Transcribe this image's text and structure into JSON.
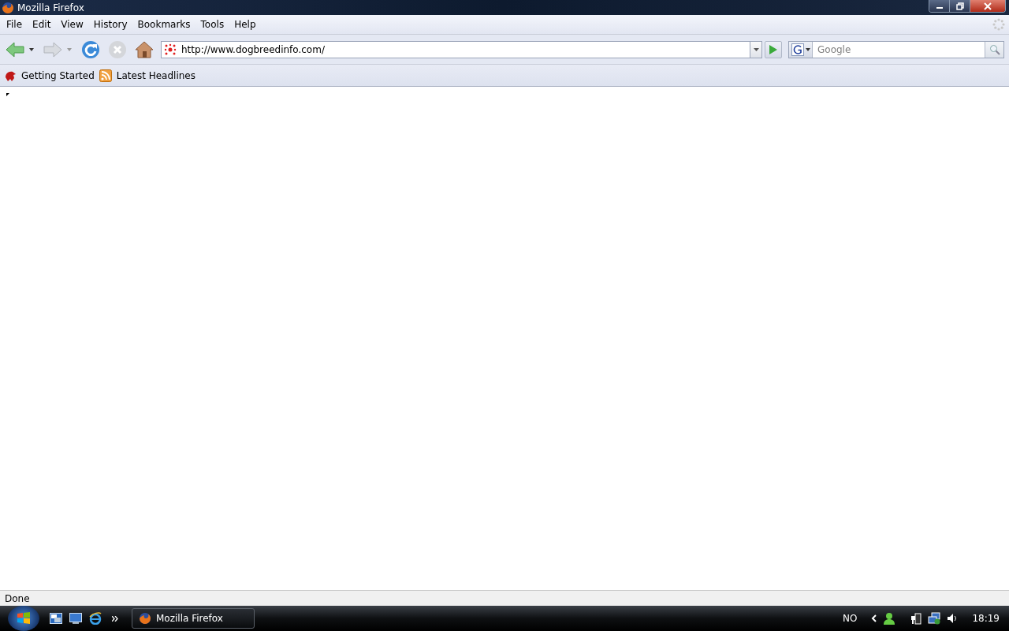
{
  "window": {
    "title": "Mozilla Firefox"
  },
  "menu": [
    "File",
    "Edit",
    "View",
    "History",
    "Bookmarks",
    "Tools",
    "Help"
  ],
  "address": {
    "url": "http://www.dogbreedinfo.com/"
  },
  "search": {
    "placeholder": "Google"
  },
  "bookmarks": [
    "Getting Started",
    "Latest Headlines"
  ],
  "status_bar": {
    "text": "Done"
  },
  "taskbar": {
    "tasks": [
      "Mozilla Firefox"
    ],
    "language": "NO",
    "clock": "18:19"
  }
}
